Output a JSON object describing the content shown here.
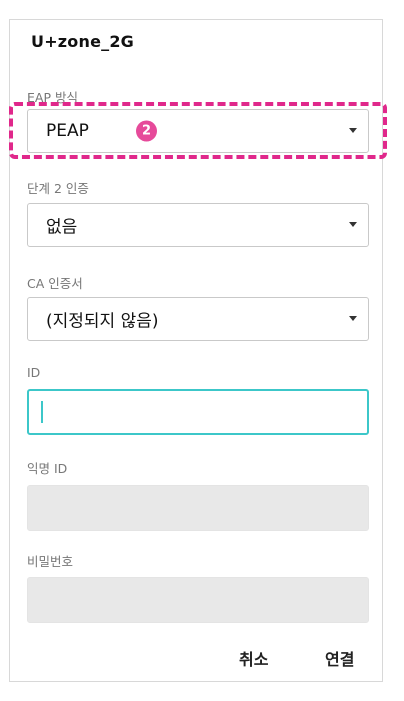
{
  "network": {
    "ssid": "U+zone_2G"
  },
  "eap_method": {
    "label": "EAP 방식",
    "value": "PEAP",
    "step_badge": "2"
  },
  "phase2_auth": {
    "label": "단계 2 인증",
    "value": "없음"
  },
  "ca_certificate": {
    "label": "CA 인증서",
    "value": "(지정되지 않음)"
  },
  "identity": {
    "label": "ID",
    "value": ""
  },
  "anonymous_identity": {
    "label": "익명 ID",
    "value": ""
  },
  "password": {
    "label": "비밀번호",
    "value": ""
  },
  "actions": {
    "cancel_label": "취소",
    "connect_label": "연결"
  },
  "colors": {
    "highlight_border": "#e0288b",
    "step_badge": "#e64a9a",
    "focus_accent": "#3cc7c9",
    "disabled_field": "#e8e8e8"
  },
  "icons": {
    "dropdown": "triangle-down",
    "text_cursor": "vertical-bar"
  }
}
